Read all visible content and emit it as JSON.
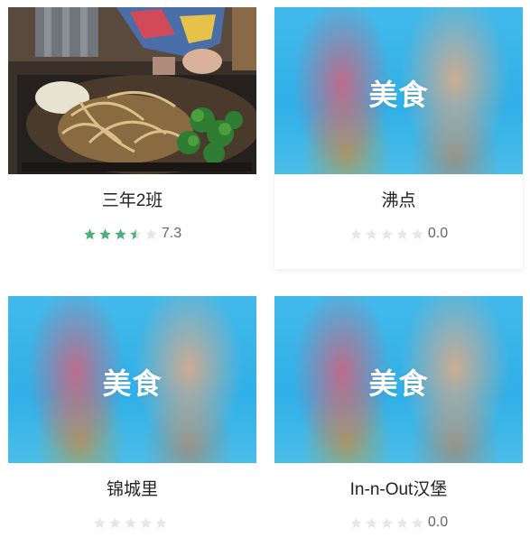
{
  "colors": {
    "star_filled": "#4caf7a",
    "star_empty": "#e6e6e6",
    "placeholder_bg": "#2fb0e8"
  },
  "restaurants": [
    {
      "name": "三年2班",
      "score": "7.3",
      "stars": 3.5,
      "image": "photo",
      "image_label": ""
    },
    {
      "name": "沸点",
      "score": "0.0",
      "stars": 0,
      "image": "placeholder",
      "image_label": "美食"
    },
    {
      "name": "锦城里",
      "score": "",
      "stars": 0,
      "image": "placeholder",
      "image_label": "美食"
    },
    {
      "name": "In-n-Out汉堡",
      "score": "0.0",
      "stars": 0,
      "image": "placeholder",
      "image_label": "美食"
    }
  ]
}
